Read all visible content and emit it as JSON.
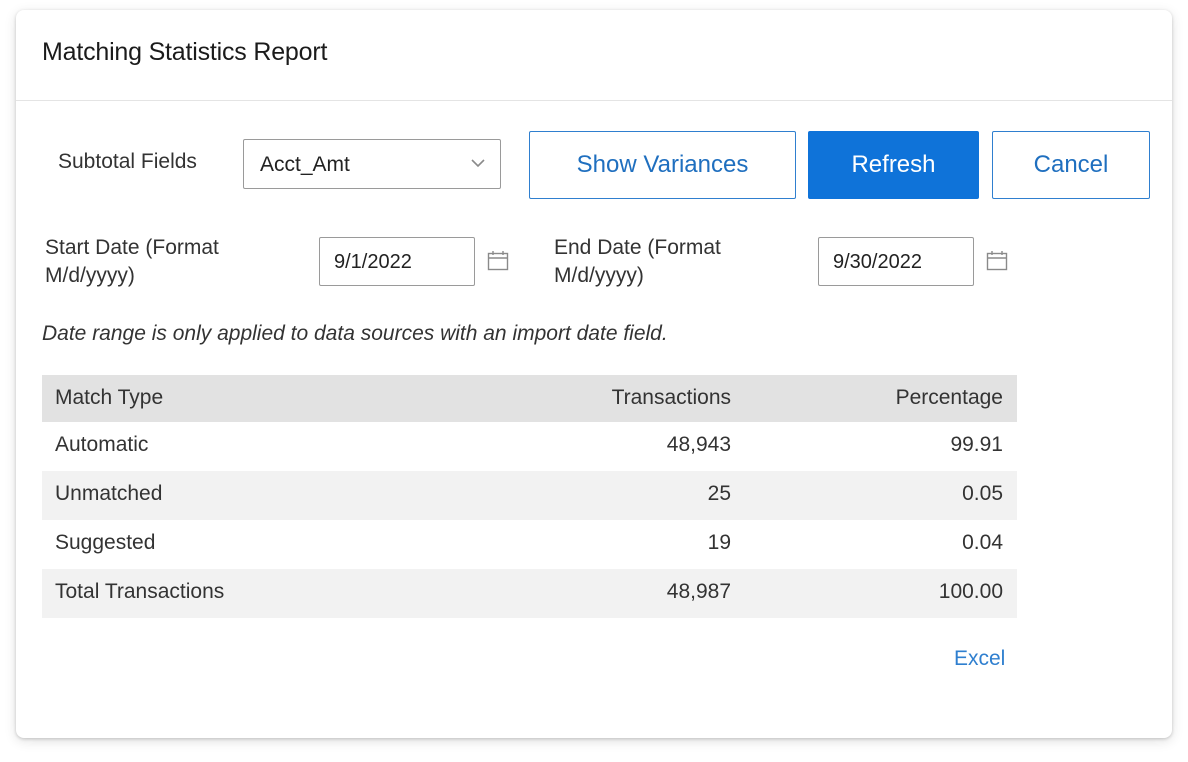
{
  "dialog": {
    "title": "Matching Statistics Report"
  },
  "filters": {
    "subtotal_label": "Subtotal Fields",
    "subtotal_value": "Acct_Amt",
    "start_label_line1": "Start Date (Format",
    "start_label_line2": "M/d/yyyy)",
    "start_value": "9/1/2022",
    "end_label_line1": "End Date (Format",
    "end_label_line2": "M/d/yyyy)",
    "end_value": "9/30/2022",
    "note": "Date range is only applied to data sources with an import date field."
  },
  "buttons": {
    "show_variances": "Show Variances",
    "refresh": "Refresh",
    "cancel": "Cancel"
  },
  "table": {
    "headers": [
      "Match Type",
      "Transactions",
      "Percentage"
    ],
    "rows": [
      [
        "Automatic",
        "48,943",
        "99.91"
      ],
      [
        "Unmatched",
        "25",
        "0.05"
      ],
      [
        "Suggested",
        "19",
        "0.04"
      ],
      [
        "Total Transactions",
        "48,987",
        "100.00"
      ]
    ]
  },
  "links": {
    "excel": "Excel"
  },
  "colors": {
    "primary": "#0f73d9",
    "link": "#2f7fcf",
    "table_header_bg": "#e2e2e2",
    "table_alt_bg": "#f2f2f2"
  },
  "icons": {
    "dropdown": "chevron-down-icon",
    "date_picker": "calendar-icon"
  }
}
